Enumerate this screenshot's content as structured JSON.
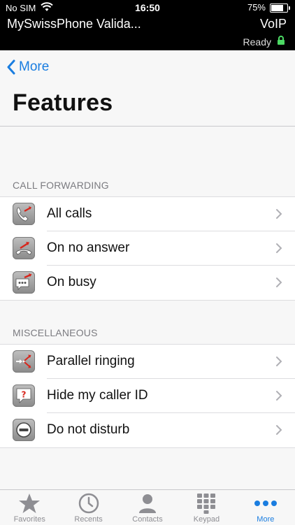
{
  "status": {
    "carrier": "No SIM",
    "time": "16:50",
    "battery": "75%",
    "battery_level": 0.75
  },
  "app": {
    "account": "MySwissPhone Valida...",
    "connection": "VoIP",
    "state": "Ready"
  },
  "nav": {
    "back_label": "More",
    "title": "Features"
  },
  "sections": {
    "forwarding": {
      "header": "CALL FORWARDING",
      "items": [
        {
          "label": "All calls",
          "icon": "phone-forward-icon"
        },
        {
          "label": "On no answer",
          "icon": "handset-forward-icon"
        },
        {
          "label": "On busy",
          "icon": "busy-bubble-forward-icon"
        }
      ]
    },
    "misc": {
      "header": "MISCELLANEOUS",
      "items": [
        {
          "label": "Parallel ringing",
          "icon": "parallel-ringing-icon"
        },
        {
          "label": "Hide my caller ID",
          "icon": "hide-caller-id-icon"
        },
        {
          "label": "Do not disturb",
          "icon": "do-not-disturb-icon"
        }
      ]
    }
  },
  "tabs": [
    {
      "label": "Favorites",
      "icon": "star-icon"
    },
    {
      "label": "Recents",
      "icon": "clock-icon"
    },
    {
      "label": "Contacts",
      "icon": "person-icon"
    },
    {
      "label": "Keypad",
      "icon": "keypad-icon"
    },
    {
      "label": "More",
      "icon": "more-icon",
      "active": true
    }
  ],
  "colors": {
    "accent": "#1a7de0",
    "forward_arrow": "#d8261c",
    "lock": "#4cd964"
  }
}
